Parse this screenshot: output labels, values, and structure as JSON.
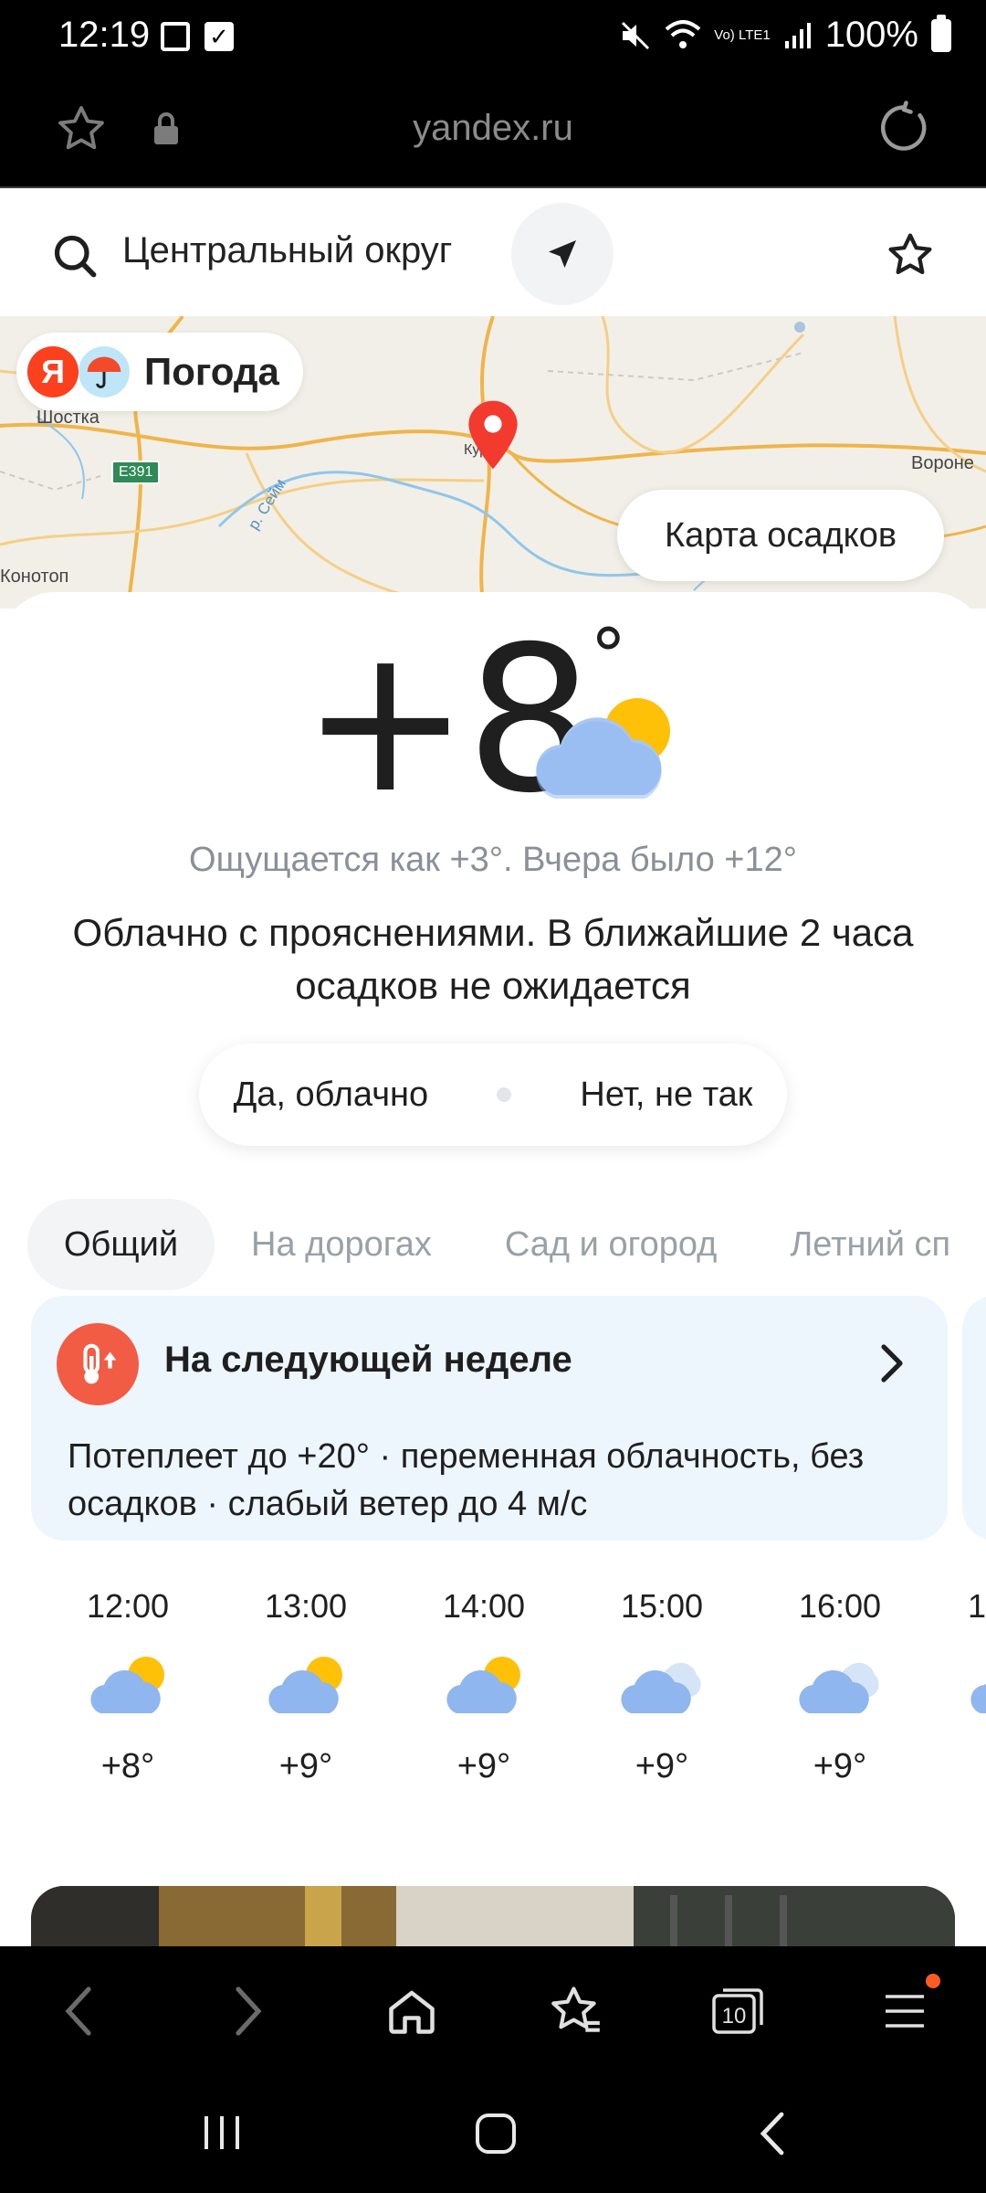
{
  "status_bar": {
    "time": "12:19",
    "battery": "100%",
    "network": "Vo) LTE1"
  },
  "browser": {
    "url": "yandex.ru"
  },
  "search": {
    "location": "Центральный округ"
  },
  "map": {
    "brand_logo_letter": "Я",
    "brand_name": "Погода",
    "labels": [
      "Шостка",
      "Курск",
      "Вороне",
      "Конотоп",
      "р. Сейм"
    ],
    "road": "E391",
    "precip_button": "Карта осадков"
  },
  "current": {
    "temp": "+8",
    "degree": "°",
    "feels_like": "Ощущается как +3°. Вчера было +12°",
    "condition": "Облачно с прояснениями. В ближайшие 2 часа осадков не ожидается",
    "feedback_yes": "Да, облачно",
    "feedback_no": "Нет, не так"
  },
  "tabs": [
    "Общий",
    "На дорогах",
    "Сад и огород",
    "Летний сп"
  ],
  "forecast_card": {
    "title": "На следующей неделе",
    "text": "Потеплеет до +20° · переменная облачность, без осадков · слабый ветер до 4 м/с"
  },
  "hourly": [
    {
      "time": "12:00",
      "temp": "+8°",
      "icon": "cloud-sun-icon"
    },
    {
      "time": "13:00",
      "temp": "+9°",
      "icon": "cloud-sun-icon"
    },
    {
      "time": "14:00",
      "temp": "+9°",
      "icon": "cloud-sun-icon"
    },
    {
      "time": "15:00",
      "temp": "+9°",
      "icon": "cloudy-icon"
    },
    {
      "time": "16:00",
      "temp": "+9°",
      "icon": "cloudy-icon"
    },
    {
      "time": "1",
      "temp": "",
      "icon": "cloudy-icon"
    }
  ],
  "browser_nav": {
    "tabs_count": "10"
  },
  "colors": {
    "accent_red": "#fc3f1d",
    "card_blue": "#eef6fd",
    "sun": "#ffc107",
    "cloud": "#8fb6ef"
  }
}
